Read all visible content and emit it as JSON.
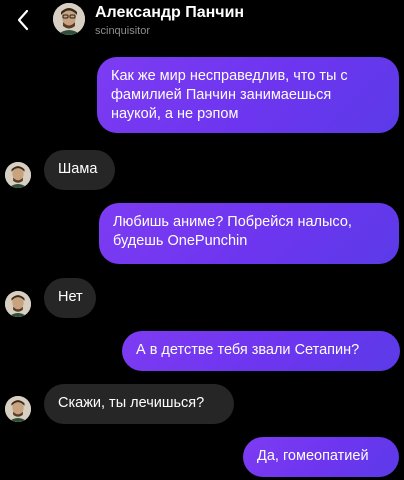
{
  "header": {
    "contact_name": "Александр Панчин",
    "username": "scinquisitor"
  },
  "icons": {
    "back": "chevron-left-icon",
    "avatar": "avatar"
  },
  "colors": {
    "background": "#000000",
    "outgoing_bubble": "#6d35ef",
    "incoming_bubble": "#262626",
    "text": "#ffffff",
    "secondary_text": "#8d8d8d"
  },
  "messages": [
    {
      "direction": "outgoing",
      "text": "Как же мир несправедлив, что ты с фамилией Панчин занимаешься наукой, а не рэпом"
    },
    {
      "direction": "incoming",
      "text": "Шама"
    },
    {
      "direction": "outgoing",
      "text": "Любишь аниме? Побрейся налысо, будешь OnePunchin"
    },
    {
      "direction": "incoming",
      "text": "Нет"
    },
    {
      "direction": "outgoing",
      "text": "А в детстве тебя звали Сетапин?"
    },
    {
      "direction": "incoming",
      "text": "Скажи, ты лечишься?"
    },
    {
      "direction": "outgoing",
      "text": "Да, гомеопатией"
    }
  ]
}
